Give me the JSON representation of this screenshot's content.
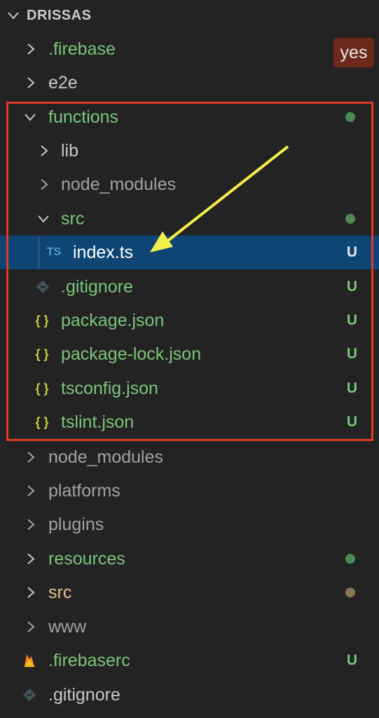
{
  "explorer": {
    "title": "DRISSAS"
  },
  "badge_yes": "yes",
  "icons": {
    "ts": "TS",
    "json": "{ }",
    "collapse": "chevron-down-icon",
    "expand": "chevron-right-icon"
  },
  "status_marker": "U",
  "colors": {
    "green": "#7cc57a",
    "folder_gray": "#c8c8c8",
    "untracked_gray": "#a2a2a2",
    "orange": "#e2c08d",
    "dot_green": "#4d8a58",
    "dot_orange": "#8b7356",
    "selection": "#0e4574",
    "highlight_box": "#e03a28",
    "annotation_arrow": "#f2ef4b"
  },
  "items": [
    {
      "label": ".firebase"
    },
    {
      "label": "e2e"
    },
    {
      "label": "functions"
    },
    {
      "label": "lib"
    },
    {
      "label": "node_modules"
    },
    {
      "label": "src"
    },
    {
      "label": "index.ts"
    },
    {
      "label": ".gitignore"
    },
    {
      "label": "package.json"
    },
    {
      "label": "package-lock.json"
    },
    {
      "label": "tsconfig.json"
    },
    {
      "label": "tslint.json"
    },
    {
      "label": "node_modules"
    },
    {
      "label": "platforms"
    },
    {
      "label": "plugins"
    },
    {
      "label": "resources"
    },
    {
      "label": "src"
    },
    {
      "label": "www"
    },
    {
      "label": ".firebaserc"
    },
    {
      "label": ".gitignore"
    }
  ]
}
